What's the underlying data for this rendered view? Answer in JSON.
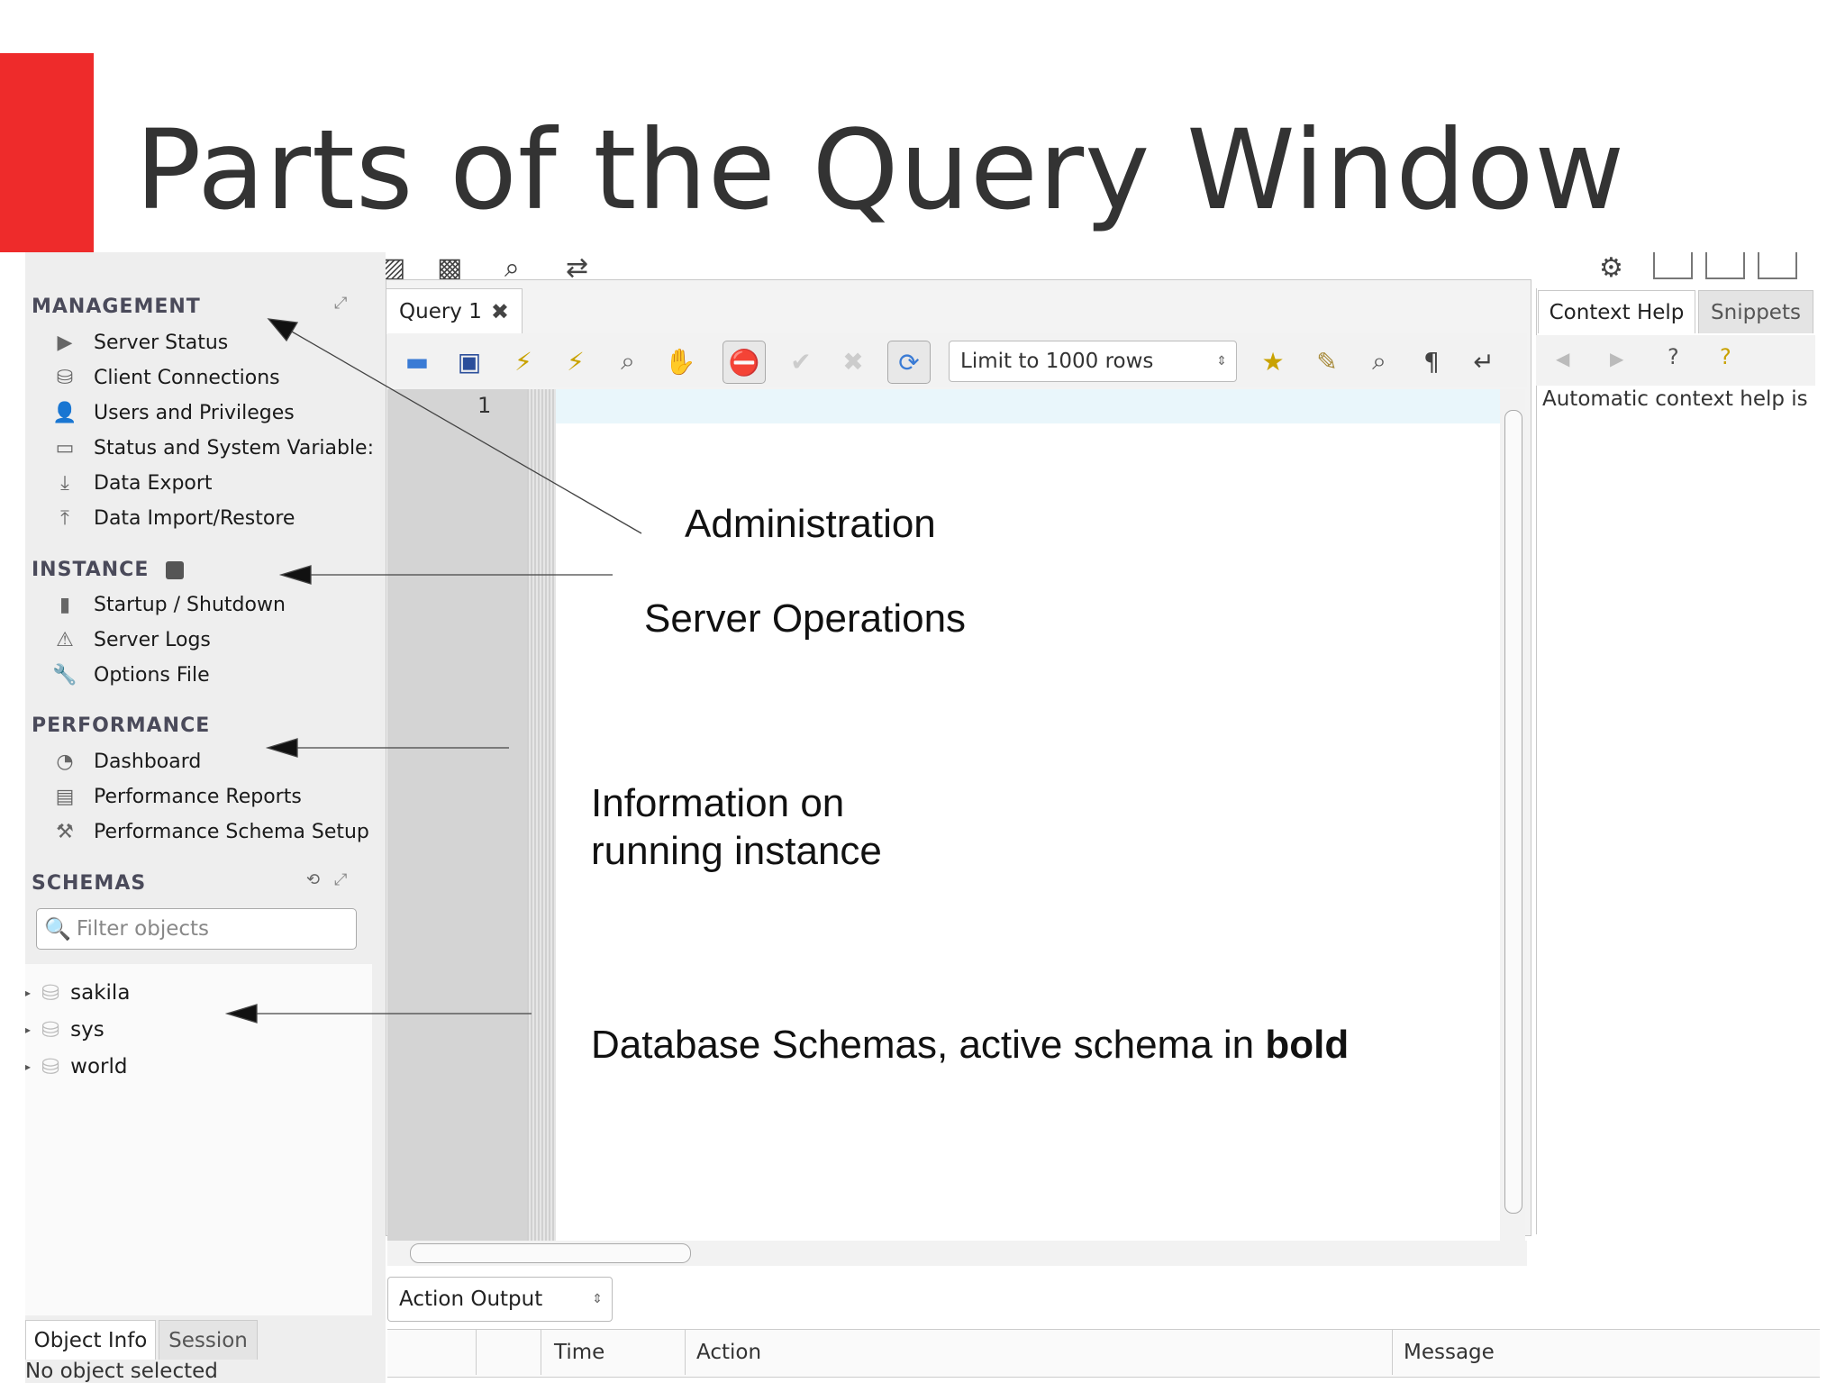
{
  "slide": {
    "title": "Parts of the Query Window"
  },
  "sidebar": {
    "management": {
      "heading": "MANAGEMENT",
      "items": [
        {
          "label": "Server Status",
          "icon": "play-icon"
        },
        {
          "label": "Client Connections",
          "icon": "connections-icon"
        },
        {
          "label": "Users and Privileges",
          "icon": "user-icon"
        },
        {
          "label": "Status and System Variable:",
          "icon": "monitor-icon"
        },
        {
          "label": "Data Export",
          "icon": "export-icon"
        },
        {
          "label": "Data Import/Restore",
          "icon": "import-icon"
        }
      ]
    },
    "instance": {
      "heading": "INSTANCE",
      "items": [
        {
          "label": "Startup / Shutdown",
          "icon": "power-icon"
        },
        {
          "label": "Server Logs",
          "icon": "warning-icon"
        },
        {
          "label": "Options File",
          "icon": "wrench-icon"
        }
      ]
    },
    "performance": {
      "heading": "PERFORMANCE",
      "items": [
        {
          "label": "Dashboard",
          "icon": "gauge-icon"
        },
        {
          "label": "Performance Reports",
          "icon": "reports-icon"
        },
        {
          "label": "Performance Schema Setup",
          "icon": "setup-icon"
        }
      ]
    },
    "schemas": {
      "heading": "SCHEMAS",
      "filter_placeholder": "Filter objects",
      "items": [
        "sakila",
        "sys",
        "world"
      ]
    },
    "bottom_tabs": [
      "Object Info",
      "Session"
    ],
    "bottom_status": "No object selected"
  },
  "editor": {
    "tab_label": "Query 1",
    "limit_label": "Limit to 1000 rows",
    "line_number": "1"
  },
  "right_panel": {
    "tabs": [
      "Context Help",
      "Snippets"
    ],
    "help_text": "Automatic context help is"
  },
  "output": {
    "select_label": "Action Output",
    "columns": [
      "Time",
      "Action",
      "Message"
    ]
  },
  "annotations": {
    "administration": "Administration",
    "server_operations": "Server Operations",
    "info_line1": "Information on",
    "info_line2": "running instance",
    "schemas_prefix": "Database Schemas, active schema in ",
    "schemas_bold": "bold"
  },
  "colors": {
    "accent_red": "#ee2b2b"
  }
}
